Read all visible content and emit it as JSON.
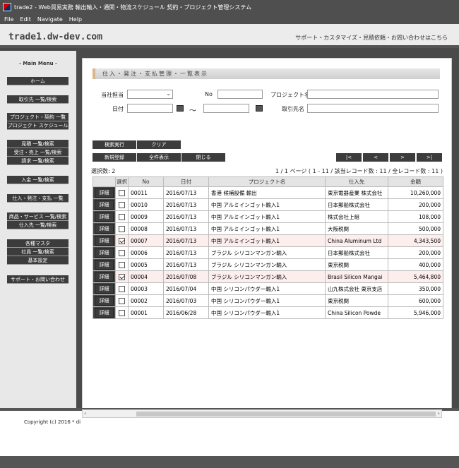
{
  "window": {
    "title": "trade2 - Web貿易実務 輸出輸入・通関・物流スケジュール 契約・プロジェクト管理システム"
  },
  "menu": [
    "File",
    "Edit",
    "Navigate",
    "Help"
  ],
  "header": {
    "site": "trade1.dw-dev.com",
    "links": "サポート・カスタマイズ・見積依頼・お問い合わせはこちら"
  },
  "sidebar": {
    "title": "- Main Menu -",
    "groups": [
      [
        "ホーム"
      ],
      [
        "取引先 一覧/検索"
      ],
      [
        "プロジェクト・契約 一覧",
        "プロジェクト スケジュール"
      ],
      [
        "見積 一覧/検索",
        "受注・売上 一覧/検索",
        "請求 一覧/検索"
      ],
      [
        "入金 一覧/検索"
      ],
      [
        "仕入・発注・支払 一覧"
      ],
      [
        "商品・サービス 一覧/検索",
        "仕入先 一覧/検索"
      ],
      [
        "各種マスタ",
        "社員 一覧/検索",
        "基本設定"
      ],
      [
        "サポート・お問い合わせ"
      ]
    ]
  },
  "page": {
    "heading": "仕入・発注・支払管理・一覧表示"
  },
  "form": {
    "staff_label": "当社担当",
    "staff_value": "",
    "no_label": "No",
    "project_label": "プロジェクト名",
    "date_label": "日付",
    "tilde": "〜",
    "supplier_label": "取引先名"
  },
  "buttons": {
    "search": "検索実行",
    "clear": "クリア",
    "new": "新規登録",
    "showall": "全件表示",
    "close": "閉じる",
    "first": "|<",
    "prev": "<",
    "next": ">",
    "last": ">|",
    "detail": "詳細"
  },
  "status": {
    "selected": "選択数: 2",
    "pager": "1 / 1 ページ ( 1 - 11 / 該当レコード数 : 11 / 全レコード数 : 11 )"
  },
  "table": {
    "columns": [
      "選択",
      "No",
      "日付",
      "プロジェクト名",
      "仕入先",
      "金額"
    ],
    "rows": [
      {
        "checked": false,
        "no": "00011",
        "date": "2016/07/13",
        "project": "香港 候補設備 輸出",
        "supplier": "東京電器産業 株式会社",
        "amount": "10,260,000"
      },
      {
        "checked": false,
        "no": "00010",
        "date": "2016/07/13",
        "project": "中国 アルミインゴット輸入1",
        "supplier": "日本郵船株式会社",
        "amount": "200,000"
      },
      {
        "checked": false,
        "no": "00009",
        "date": "2016/07/13",
        "project": "中国 アルミインゴット輸入1",
        "supplier": "株式会社上組",
        "amount": "108,000"
      },
      {
        "checked": false,
        "no": "00008",
        "date": "2016/07/13",
        "project": "中国 アルミインゴット輸入1",
        "supplier": "大阪税関",
        "amount": "500,000"
      },
      {
        "checked": true,
        "no": "00007",
        "date": "2016/07/13",
        "project": "中国 アルミインゴット輸入1",
        "supplier": "China Aluminum Ltd",
        "amount": "4,343,500"
      },
      {
        "checked": false,
        "no": "00006",
        "date": "2016/07/13",
        "project": "ブラジル シリコンマンガン輸入",
        "supplier": "日本郵船株式会社",
        "amount": "200,000"
      },
      {
        "checked": false,
        "no": "00005",
        "date": "2016/07/13",
        "project": "ブラジル シリコンマンガン輸入",
        "supplier": "東京税関",
        "amount": "400,000"
      },
      {
        "checked": true,
        "no": "00004",
        "date": "2016/07/08",
        "project": "ブラジル シリコンマンガン輸入",
        "supplier": "Brasil Silicon Mangai",
        "amount": "5,464,800"
      },
      {
        "checked": false,
        "no": "00003",
        "date": "2016/07/04",
        "project": "中国 シリコンパウダー輸入1",
        "supplier": "山九株式会社 東京支店",
        "amount": "350,000"
      },
      {
        "checked": false,
        "no": "00002",
        "date": "2016/07/03",
        "project": "中国 シリコンパウダー輸入1",
        "supplier": "東京税関",
        "amount": "600,000"
      },
      {
        "checked": false,
        "no": "00001",
        "date": "2016/06/28",
        "project": "中国 シリコンパウダー輸入1",
        "supplier": "China Silicon Powde",
        "amount": "5,946,000"
      }
    ]
  },
  "footer": {
    "copyright": "Copyright (c) 2016 * di"
  }
}
